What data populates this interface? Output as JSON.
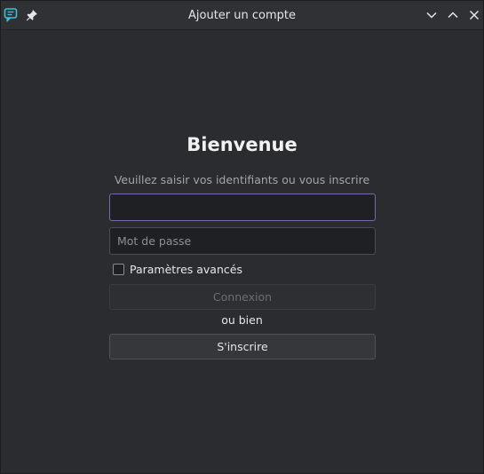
{
  "window": {
    "title": "Ajouter un compte",
    "app_icon": "chat-bubble-icon",
    "pin_icon": "pin-icon",
    "controls": [
      "chevron-down-icon",
      "chevron-up-icon",
      "close-icon"
    ]
  },
  "form": {
    "heading": "Bienvenue",
    "subtitle": "Veuillez saisir vos identifiants ou vous inscrire",
    "username": {
      "value": "",
      "placeholder": ""
    },
    "password": {
      "value": "",
      "placeholder": "Mot de passe"
    },
    "advanced_label": "Paramètres avancés",
    "advanced_checked": false,
    "login_label": "Connexion",
    "login_enabled": false,
    "or_text": "ou bien",
    "register_label": "S'inscrire"
  },
  "colors": {
    "background": "#2a2c2f",
    "accent": "#7c68a8",
    "app_icon": "#3cbfd9"
  }
}
